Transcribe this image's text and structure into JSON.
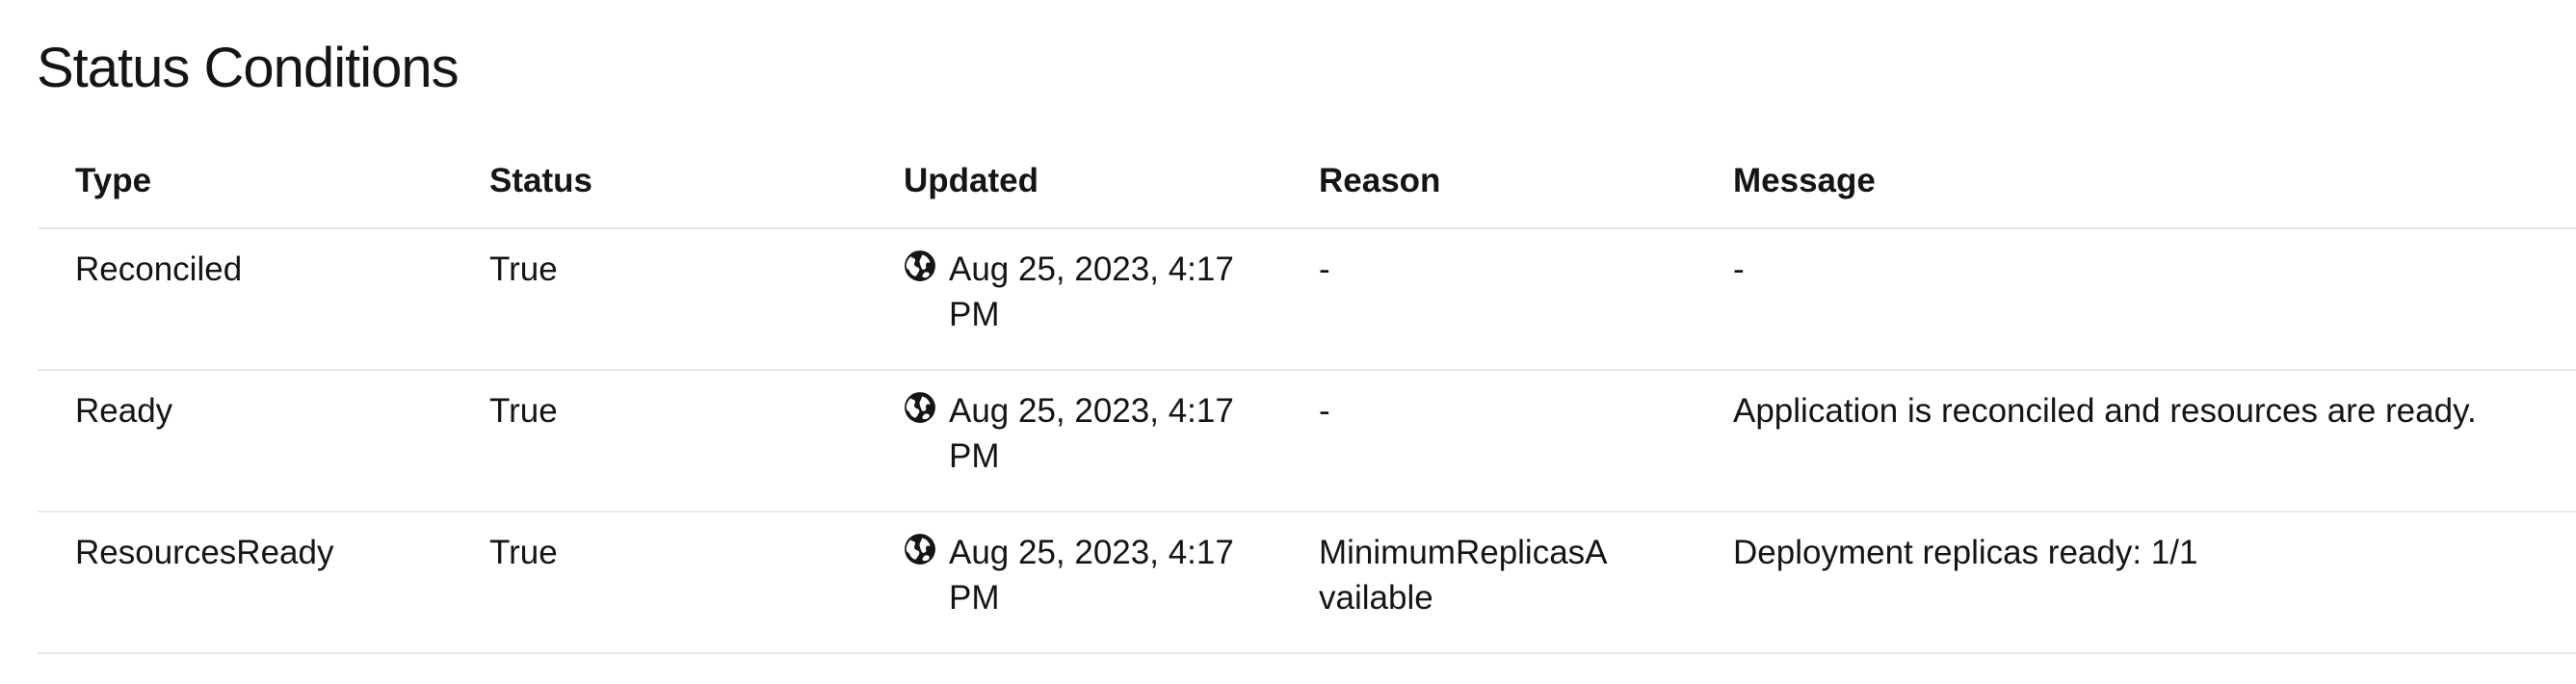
{
  "section": {
    "title": "Status Conditions"
  },
  "table": {
    "columns": {
      "type": "Type",
      "status": "Status",
      "updated": "Updated",
      "reason": "Reason",
      "message": "Message"
    },
    "rows": [
      {
        "type": "Reconciled",
        "status": "True",
        "updated": "Aug 25, 2023, 4:17 PM",
        "updated_icon": "globe-icon",
        "reason": "-",
        "message": "-"
      },
      {
        "type": "Ready",
        "status": "True",
        "updated": "Aug 25, 2023, 4:17 PM",
        "updated_icon": "globe-icon",
        "reason": "-",
        "message": "Application is reconciled and resources are ready."
      },
      {
        "type": "ResourcesReady",
        "status": "True",
        "updated": "Aug 25, 2023, 4:17 PM",
        "updated_icon": "globe-icon",
        "reason": "MinimumReplicasAvailable",
        "message": "Deployment replicas ready: 1/1"
      }
    ]
  },
  "colors": {
    "text": "#151515",
    "divider": "#e6e6e6",
    "background": "#ffffff"
  }
}
